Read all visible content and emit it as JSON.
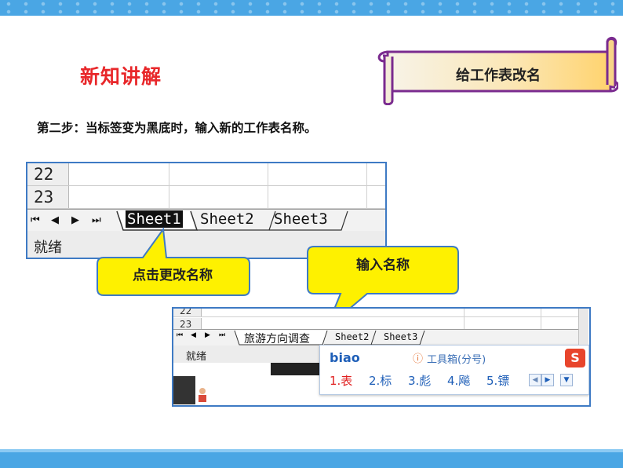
{
  "header": {
    "section_title": "新知讲解",
    "banner_title": "给工作表改名"
  },
  "instruction": "第二步：当标签变为黑底时，输入新的工作表名称。",
  "screenshot1": {
    "rows": [
      "22",
      "23"
    ],
    "nav_buttons": [
      "⏮",
      "◀",
      "▶",
      "⏭"
    ],
    "tabs": [
      "Sheet1",
      "Sheet2",
      "Sheet3"
    ],
    "status": "就绪"
  },
  "callouts": {
    "click_label": "点击更改名称",
    "input_label": "输入名称"
  },
  "screenshot2": {
    "rows": [
      "22",
      "23"
    ],
    "nav_buttons": [
      "⏮",
      "◀",
      "▶",
      "⏭"
    ],
    "tabs": [
      "旅游方向调查",
      "Sheet2",
      "Sheet3"
    ],
    "status": "就绪",
    "ime": {
      "input": "biao",
      "toolbox": "工具箱(分号)",
      "candidates": [
        "1.表",
        "2.标",
        "3.彪",
        "4.飚",
        "5.镖"
      ],
      "logo": "S"
    }
  },
  "colors": {
    "accent_red": "#e8272a",
    "frame_blue": "#3e7ac4",
    "callout_yellow": "#fef100",
    "banner_purple": "#7a2b8f",
    "bar_blue": "#4aa6e4"
  }
}
